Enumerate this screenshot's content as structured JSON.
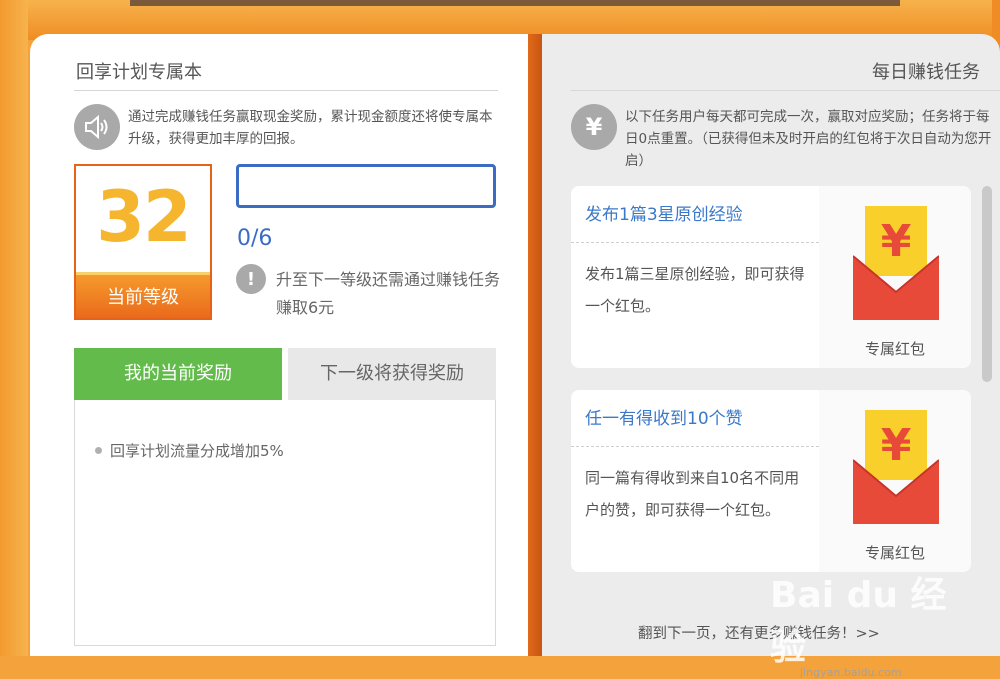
{
  "left": {
    "title": "回享计划专属本",
    "notice": "通过完成赚钱任务赢取现金奖励，累计现金额度还将使专属本升级，获得更加丰厚的回报。",
    "level": {
      "value": "32",
      "label": "当前等级"
    },
    "progress": {
      "text": "0/6",
      "fraction": 0
    },
    "upgrade_hint": "升至下一等级还需通过赚钱任务赚取6元",
    "tabs": {
      "current": "我的当前奖励",
      "next": "下一级将获得奖励"
    },
    "rewards": [
      "回享计划流量分成增加5%"
    ]
  },
  "right": {
    "title": "每日赚钱任务",
    "notice": "以下任务用户每天都可完成一次，赢取对应奖励；任务将于每日0点重置。（已获得但未及时开启的红包将于次日自动为您开启）",
    "tasks": [
      {
        "title": "发布1篇3星原创经验",
        "desc": "发布1篇三星原创经验，即可获得一个红包。",
        "reward": "专属红包"
      },
      {
        "title": "任一有得收到10个赞",
        "desc": "同一篇有得收到来自10名不同用户的赞，即可获得一个红包。",
        "reward": "专属红包"
      }
    ],
    "next_page": "翻到下一页，还有更多赚钱任务！>>"
  },
  "icons": {
    "notice": "speaker-icon",
    "yen": "yen-icon",
    "info": "exclamation-icon",
    "envelope": "red-envelope-icon"
  },
  "colors": {
    "accent_blue": "#3a6cc4",
    "tab_green": "#62bb4b",
    "level_orange": "#e4621a",
    "level_yellow": "#f6b52e",
    "envelope_red": "#e84a3a",
    "envelope_yellow": "#f9cf2b"
  },
  "watermark": {
    "brand": "Bai du 经验",
    "sub": "jingyan.baidu.com"
  }
}
